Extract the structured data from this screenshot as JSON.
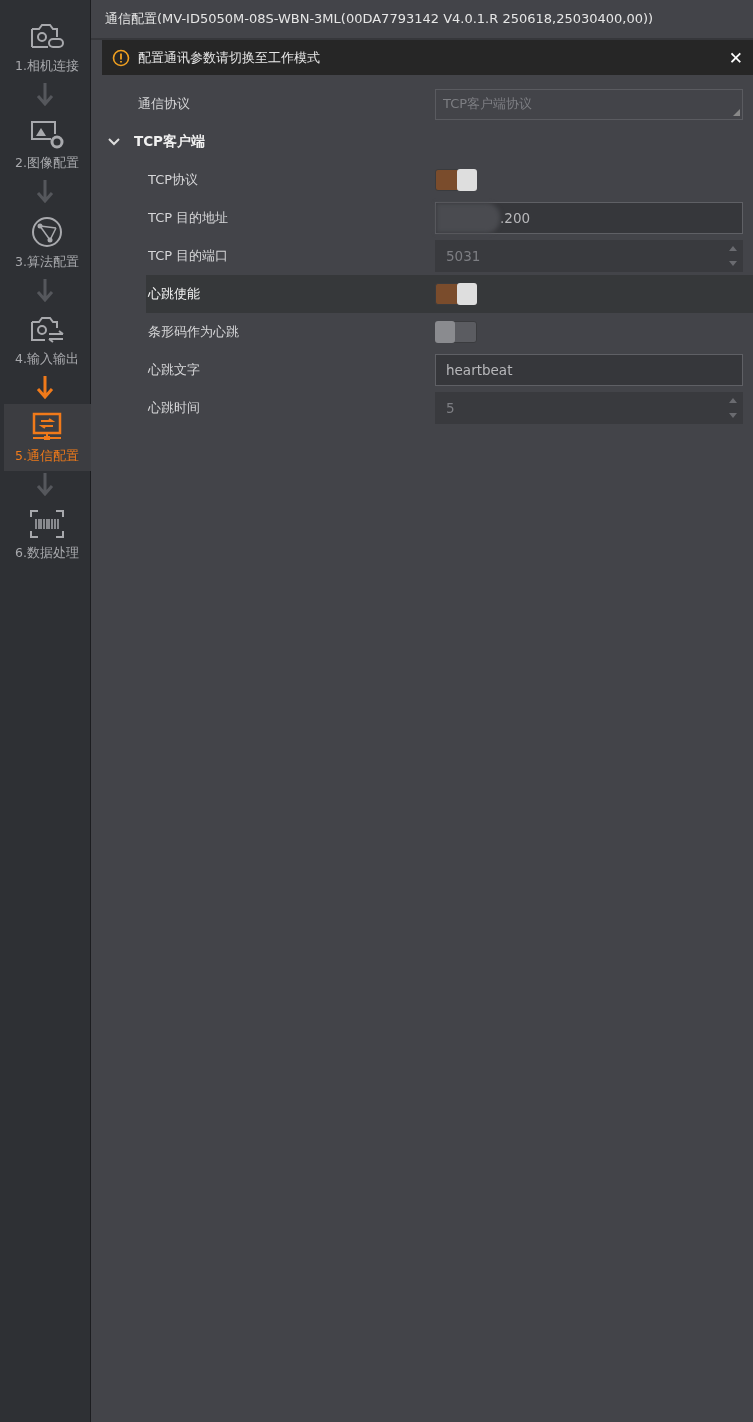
{
  "sidebar": {
    "steps": [
      {
        "label": "1.相机连接",
        "selected": false
      },
      {
        "label": "2.图像配置",
        "selected": false
      },
      {
        "label": "3.算法配置",
        "selected": false
      },
      {
        "label": "4.输入输出",
        "selected": false
      },
      {
        "label": "5.通信配置",
        "selected": true
      },
      {
        "label": "6.数据处理",
        "selected": false
      }
    ]
  },
  "window": {
    "title": "通信配置(MV-ID5050M-08S-WBN-3ML(00DA7793142 V4.0.1.R 250618,25030400,00))"
  },
  "warning": {
    "text": "配置通讯参数请切换至工作模式",
    "close": "✕"
  },
  "protocol": {
    "label": "通信协议",
    "value": "TCP客户端协议",
    "disabled": true
  },
  "group": {
    "title": "TCP客户端",
    "expanded": true,
    "rows": [
      {
        "kind": "toggle",
        "label": "TCP协议",
        "on": true,
        "selected": false
      },
      {
        "kind": "text",
        "label": "TCP 目的地址",
        "value": ".200",
        "disabled": false,
        "redacted": true,
        "selected": false
      },
      {
        "kind": "spin",
        "label": "TCP 目的端口",
        "value": "5031",
        "disabled": true,
        "selected": false
      },
      {
        "kind": "toggle",
        "label": "心跳使能",
        "on": true,
        "selected": true
      },
      {
        "kind": "toggle",
        "label": "条形码作为心跳",
        "on": false,
        "selected": false
      },
      {
        "kind": "text",
        "label": "心跳文字",
        "value": "heartbeat",
        "disabled": false,
        "selected": false
      },
      {
        "kind": "spin",
        "label": "心跳时间",
        "value": "5",
        "disabled": true,
        "selected": false
      }
    ]
  }
}
